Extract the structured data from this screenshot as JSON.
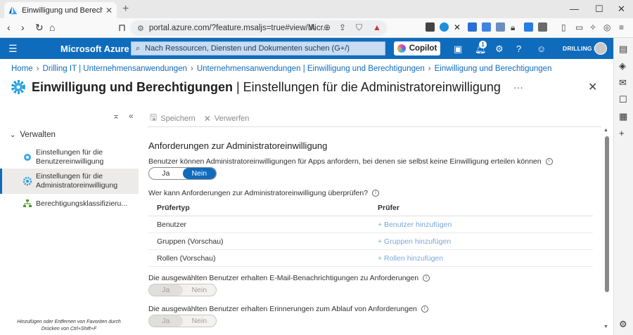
{
  "browser": {
    "tab_title": "Einwilligung und Berechtigungen",
    "new_tab": "+",
    "url": "portal.azure.com/?feature.msaljs=true#view/Micr..."
  },
  "azure": {
    "brand": "Microsoft Azure",
    "search_placeholder": "Nach Ressourcen, Diensten und Dokumenten suchen (G+/)",
    "copilot_label": "Copilot",
    "notification_count": "1",
    "tenant": "DRILLING IT"
  },
  "breadcrumb": [
    "Home",
    "Drilling IT | Unternehmensanwendungen",
    "Unternehmensanwendungen | Einwilligung und Berechtigungen",
    "Einwilligung und Berechtigungen"
  ],
  "page": {
    "title_bold": "Einwilligung und Berechtigungen",
    "title_rest": " | Einstellungen für die Administratoreinwilligung",
    "more": "···"
  },
  "leftnav": {
    "group": "Verwalten",
    "items": [
      {
        "label": "Einstellungen für die Benutzereinwilligung"
      },
      {
        "label": "Einstellungen für die Administratoreinwilligung"
      },
      {
        "label": "Berechtigungsklassifizieru..."
      }
    ],
    "hint_line1": "Hinzufügen oder Entfernen von Favoriten durch",
    "hint_line2": "Drücken von Ctrl+Shift+F"
  },
  "toolbar": {
    "save_label": "Speichern",
    "discard_label": "Verwerfen"
  },
  "content": {
    "section_title": "Anforderungen zur Administratoreinwilligung",
    "q1": "Benutzer können Administratoreinwilligungen für Apps anfordern, bei denen sie selbst keine Einwilligung erteilen können",
    "q1_toggle": {
      "yes": "Ja",
      "no": "Nein",
      "selected": "Nein"
    },
    "q2": "Wer kann Anforderungen zur Administratoreinwilligung überprüfen?",
    "table": {
      "headers": [
        "Prüfertyp",
        "Prüfer"
      ],
      "rows": [
        {
          "type": "Benutzer",
          "action": "+ Benutzer hinzufügen"
        },
        {
          "type": "Gruppen (Vorschau)",
          "action": "+ Gruppen hinzufügen"
        },
        {
          "type": "Rollen (Vorschau)",
          "action": "+ Rollen hinzufügen"
        }
      ]
    },
    "q3": "Die ausgewählten Benutzer erhalten E-Mail-Benachrichtigungen zu Anforderungen",
    "q3_toggle": {
      "yes": "Ja",
      "no": "Nein"
    },
    "q4": "Die ausgewählten Benutzer erhalten Erinnerungen zum Ablauf von Anforderungen",
    "q4_toggle": {
      "yes": "Ja",
      "no": "Nein"
    }
  },
  "colors": {
    "azure_blue": "#0f6cbd",
    "disabled_link": "#7aa7d6"
  }
}
